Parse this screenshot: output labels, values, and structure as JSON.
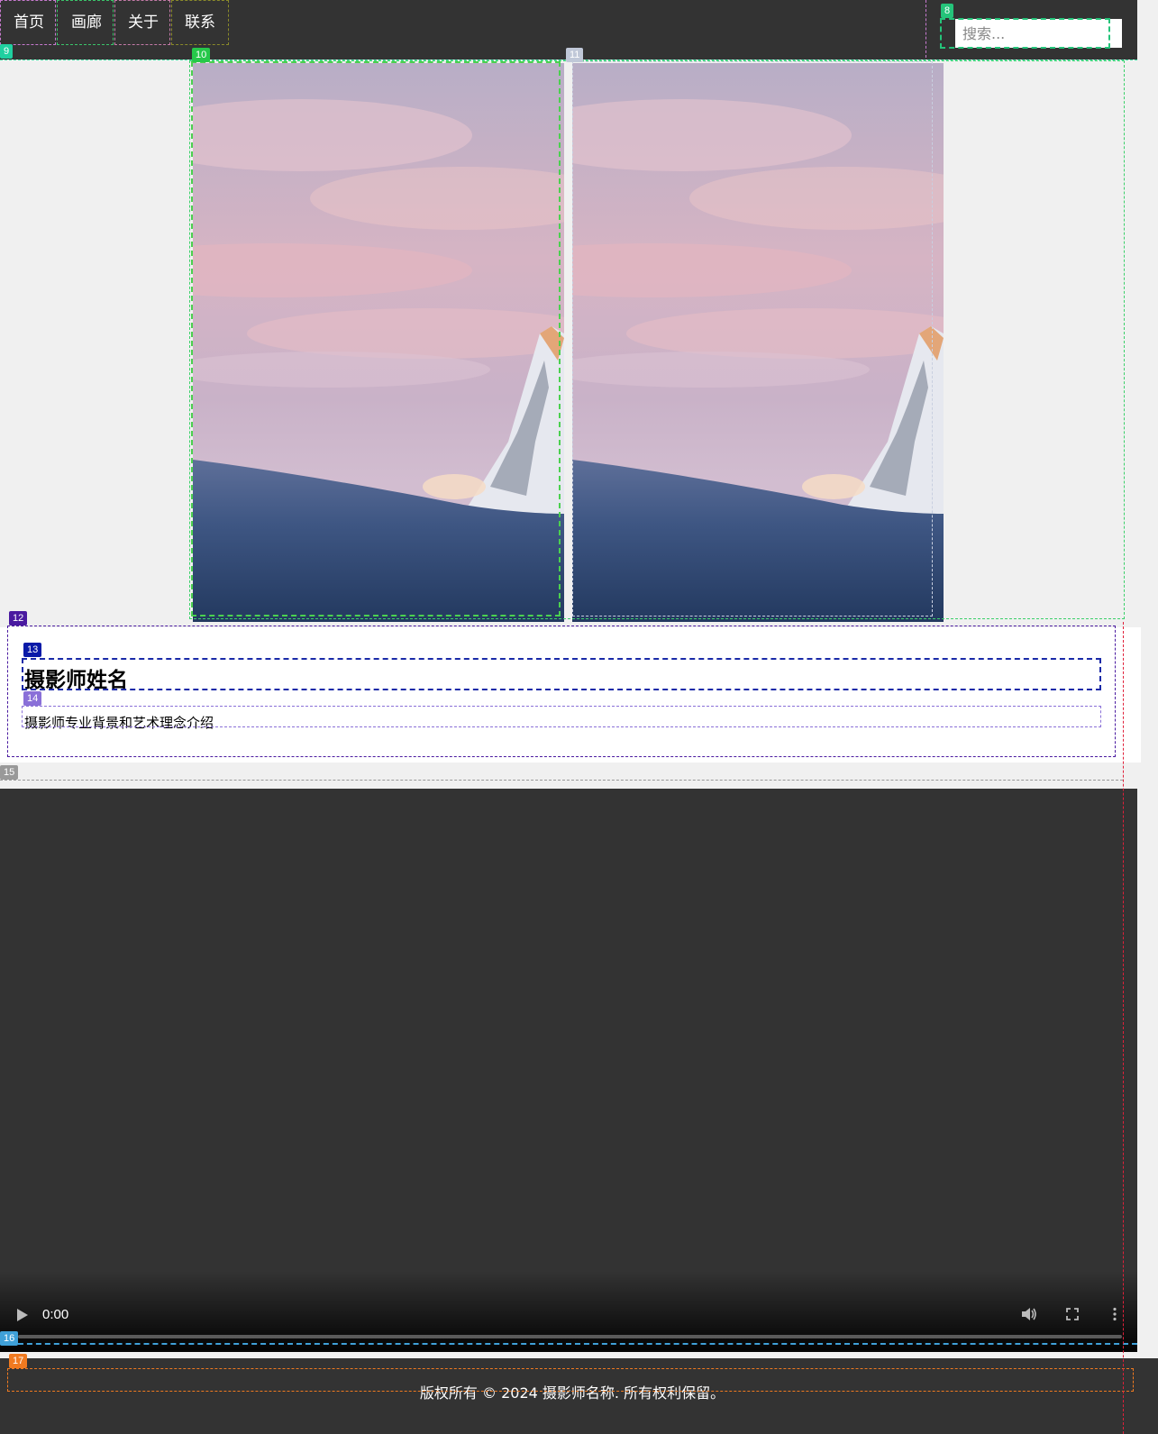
{
  "nav": {
    "items": [
      {
        "label": "首页"
      },
      {
        "label": "画廊"
      },
      {
        "label": "关于"
      },
      {
        "label": "联系"
      }
    ]
  },
  "search": {
    "placeholder": "搜索..."
  },
  "gallery": {
    "images": [
      {
        "description": "mountain-sunset-photo"
      },
      {
        "description": "mountain-sunset-photo"
      }
    ]
  },
  "about": {
    "title": "摄影师姓名",
    "bio": "摄影师专业背景和艺术理念介绍"
  },
  "video": {
    "time": "0:00"
  },
  "footer": {
    "copyright": "版权所有 © 2024 摄影师名称. 所有权利保留。"
  },
  "annotation_labels": [
    "8",
    "9",
    "10",
    "11",
    "12",
    "13",
    "14",
    "15",
    "16",
    "17"
  ],
  "colors": {
    "header_bg": "#333333",
    "page_bg": "#f0f0f0",
    "footer_bg": "#333333"
  }
}
